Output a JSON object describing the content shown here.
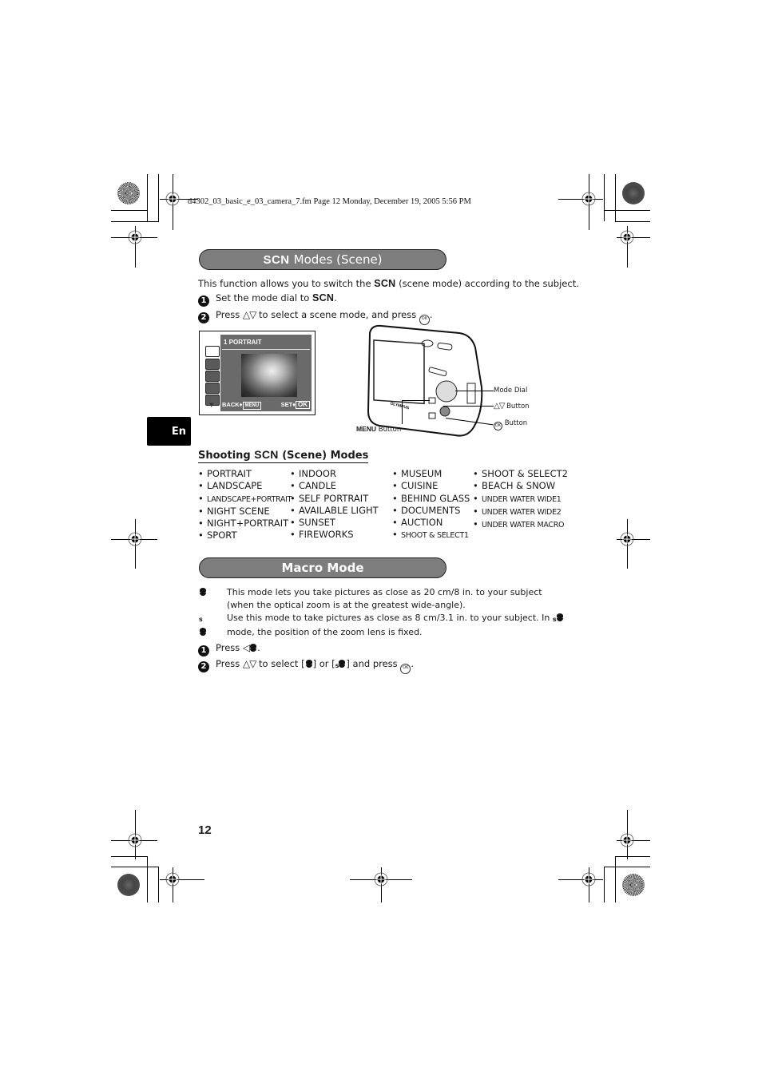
{
  "header_note": "d4302_03_basic_e_03_camera_7.fm  Page 12  Monday, December 19, 2005  5:56 PM",
  "scn_section": {
    "title_icon": "SCN",
    "title": "Modes (Scene)",
    "intro_pre": "This function allows you to switch the ",
    "intro_icon": "SCN",
    "intro_post": " (scene mode) according to the subject.",
    "steps": [
      {
        "num": "1",
        "pre": "Set the mode dial to ",
        "icon": "SCN",
        "post": "."
      },
      {
        "num": "2",
        "pre": "Press ",
        "arrows": "△▽",
        "mid": " to select a scene mode, and press ",
        "ok": "OK FUNC",
        "post": "."
      }
    ]
  },
  "lcd": {
    "title": "1   PORTRAIT",
    "back_label": "BACK♦",
    "back_button": "MENU",
    "set_label": "SET♦",
    "set_button": "OK",
    "icons": [
      "portrait-mode-icon",
      "landscape-mode-icon",
      "landscape-portrait-mode-icon",
      "night-scene-mode-icon",
      "sport-mode-icon"
    ]
  },
  "camera_callouts": {
    "mode_dial": "Mode Dial",
    "arrow_button_icon": "△▽",
    "arrow_button": "Button",
    "ok_button": "Button",
    "menu_button_bold": "MENU",
    "menu_button": "Button"
  },
  "lang_tab": "En",
  "shooting_modes": {
    "heading_pre": "Shooting ",
    "heading_icon": "SCN",
    "heading_post": " (Scene) Modes",
    "columns": [
      [
        "PORTRAIT",
        "LANDSCAPE",
        "LANDSCAPE+PORTRAIT",
        "NIGHT SCENE",
        "NIGHT+PORTRAIT",
        "SPORT"
      ],
      [
        "INDOOR",
        "CANDLE",
        "SELF PORTRAIT",
        "AVAILABLE LIGHT",
        "SUNSET",
        "FIREWORKS"
      ],
      [
        "MUSEUM",
        "CUISINE",
        "BEHIND GLASS",
        "DOCUMENTS",
        "AUCTION",
        "SHOOT & SELECT1"
      ],
      [
        "SHOOT & SELECT2",
        "BEACH & SNOW",
        "UNDER WATER WIDE1",
        "UNDER WATER WIDE2",
        "UNDER WATER MACRO"
      ]
    ],
    "bullet": "•"
  },
  "macro_section": {
    "title": "Macro Mode",
    "items": [
      {
        "icon": "macro",
        "text": "This mode lets you take pictures as close as 20 cm/8 in. to your subject (when the optical zoom is at the greatest wide-angle)."
      },
      {
        "icon": "super-macro",
        "text_pre": "Use this mode to take pictures as close as 8 cm/3.1 in. to your subject. In ",
        "text_post": " mode, the position of the zoom lens is fixed."
      }
    ],
    "steps": [
      {
        "num": "1",
        "pre": "Press ",
        "arrow": "◁",
        "post": "."
      },
      {
        "num": "2",
        "pre": "Press ",
        "arrows": "△▽",
        "mid1": " to select [",
        "mid2": "] or [",
        "mid3": "] and press ",
        "post": "."
      }
    ]
  },
  "page_number": "12"
}
